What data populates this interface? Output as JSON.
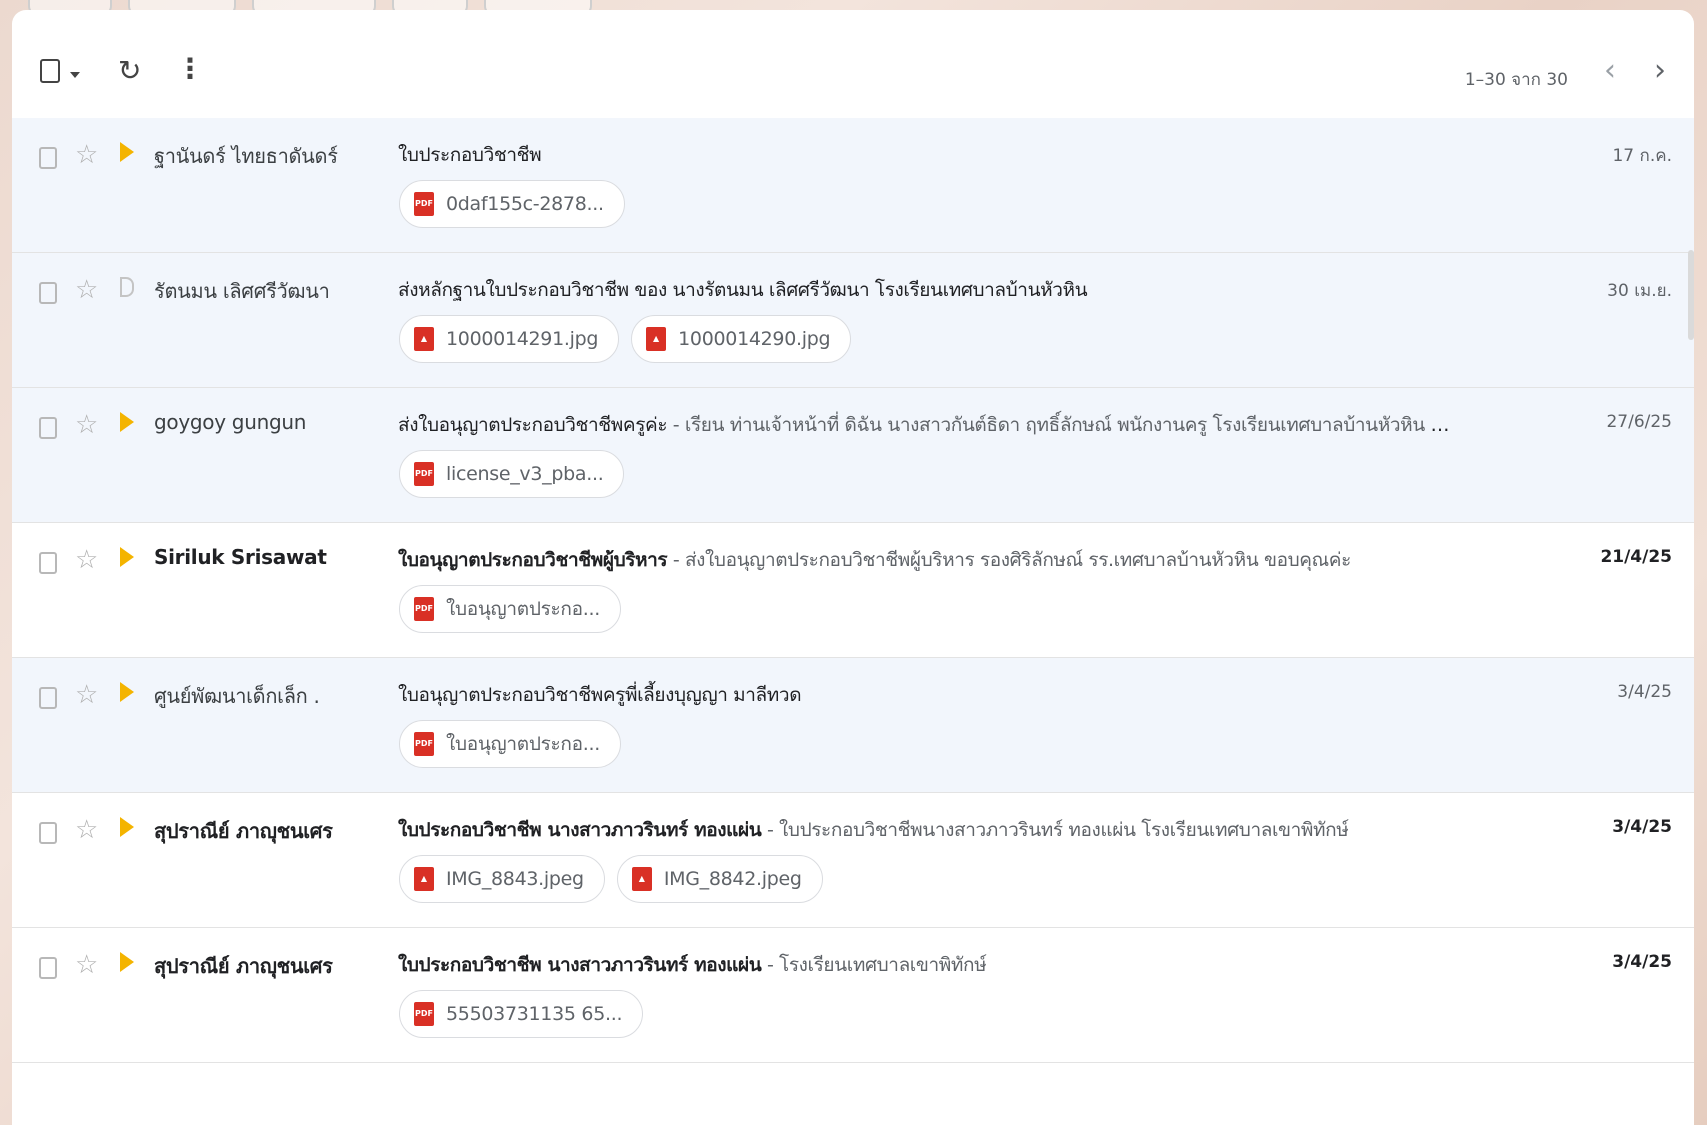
{
  "toolbar": {
    "refresh_glyph": "↻",
    "more_glyph": "⋮",
    "pager_text": "1–30 จาก 30",
    "prev_glyph": "‹",
    "next_glyph": "›"
  },
  "colors": {
    "accent_important": "#f4b400",
    "attachment_icon": "#d93025",
    "row_read_bg": "#f2f6fc"
  },
  "emails": [
    {
      "state": "read",
      "important": true,
      "sender": "ฐานันดร์ ไทยธาดันดร์",
      "subject": "ใบประกอบวิชาชีพ",
      "snippet": "",
      "date": "17 ก.ค.",
      "attachments": [
        {
          "type": "pdf",
          "icon": "pdf-icon",
          "label": "PDF",
          "name": "0daf155c-2878..."
        }
      ]
    },
    {
      "state": "read",
      "important": false,
      "sender": "รัตนมน เลิศศรีวัฒนา",
      "subject": "ส่งหลักฐานใบประกอบวิชาชีพ ของ นางรัตนมน เลิศศรีวัฒนา โรงเรียนเทศบาลบ้านหัวหิน",
      "snippet": "",
      "date": "30 เม.ย.",
      "attachments": [
        {
          "type": "image",
          "icon": "image-icon",
          "label": "▲",
          "name": "1000014291.jpg"
        },
        {
          "type": "image",
          "icon": "image-icon",
          "label": "▲",
          "name": "1000014290.jpg"
        }
      ]
    },
    {
      "state": "read",
      "important": true,
      "sender": "goygoy gungun",
      "subject": "ส่งใบอนุญาตประกอบวิชาชีพครูค่ะ",
      "snippet": " - เรียน ท่านเจ้าหน้าที่ ดิฉัน นางสาวกันต์ธิดา ฤทธิ์ลักษณ์ พนักงานครู โรงเรียนเทศบาลบ้านหัวหิน ขอส่งใบอนุญาต...",
      "date": "27/6/25",
      "attachments": [
        {
          "type": "pdf",
          "icon": "pdf-icon",
          "label": "PDF",
          "name": "license_v3_pba..."
        }
      ]
    },
    {
      "state": "unread",
      "important": true,
      "sender": "Siriluk Srisawat",
      "subject": "ใบอนุญาตประกอบวิชาชีพผู้บริหาร",
      "snippet": " - ส่งใบอนุญาตประกอบวิชาชีพผู้บริหาร รองศิริลักษณ์ รร.เทศบาลบ้านหัวหิน ขอบคุณค่ะ",
      "date": "21/4/25",
      "attachments": [
        {
          "type": "pdf",
          "icon": "pdf-icon",
          "label": "PDF",
          "name": "ใบอนุญาตประกอ..."
        }
      ]
    },
    {
      "state": "read",
      "important": true,
      "sender": "ศูนย์พัฒนาเด็กเล็ก .",
      "subject": "ใบอนุญาตประกอบวิชาชีพครูพี่เลี้ยงบุญญา มาลีทวด",
      "snippet": "",
      "date": "3/4/25",
      "attachments": [
        {
          "type": "pdf",
          "icon": "pdf-icon",
          "label": "PDF",
          "name": "ใบอนุญาตประกอ..."
        }
      ]
    },
    {
      "state": "unread",
      "important": true,
      "sender": "สุปราณีย์ ภาญุชนเศร",
      "subject": "ใบประกอบวิชาชีพ นางสาวภาวรินทร์ ทองแผ่น",
      "snippet": " - ใบประกอบวิชาชีพนางสาวภาวรินทร์ ทองแผ่น โรงเรียนเทศบาลเขาพิทักษ์",
      "date": "3/4/25",
      "attachments": [
        {
          "type": "image",
          "icon": "image-icon",
          "label": "▲",
          "name": "IMG_8843.jpeg"
        },
        {
          "type": "image",
          "icon": "image-icon",
          "label": "▲",
          "name": "IMG_8842.jpeg"
        }
      ]
    },
    {
      "state": "unread",
      "important": true,
      "sender": "สุปราณีย์ ภาญุชนเศร",
      "subject": "ใบประกอบวิชาชีพ นางสาวภาวรินทร์ ทองแผ่น",
      "snippet": " - โรงเรียนเทศบาลเขาพิทักษ์",
      "date": "3/4/25",
      "attachments": [
        {
          "type": "pdf",
          "icon": "pdf-icon",
          "label": "PDF",
          "name": "55503731135 65..."
        }
      ]
    }
  ]
}
